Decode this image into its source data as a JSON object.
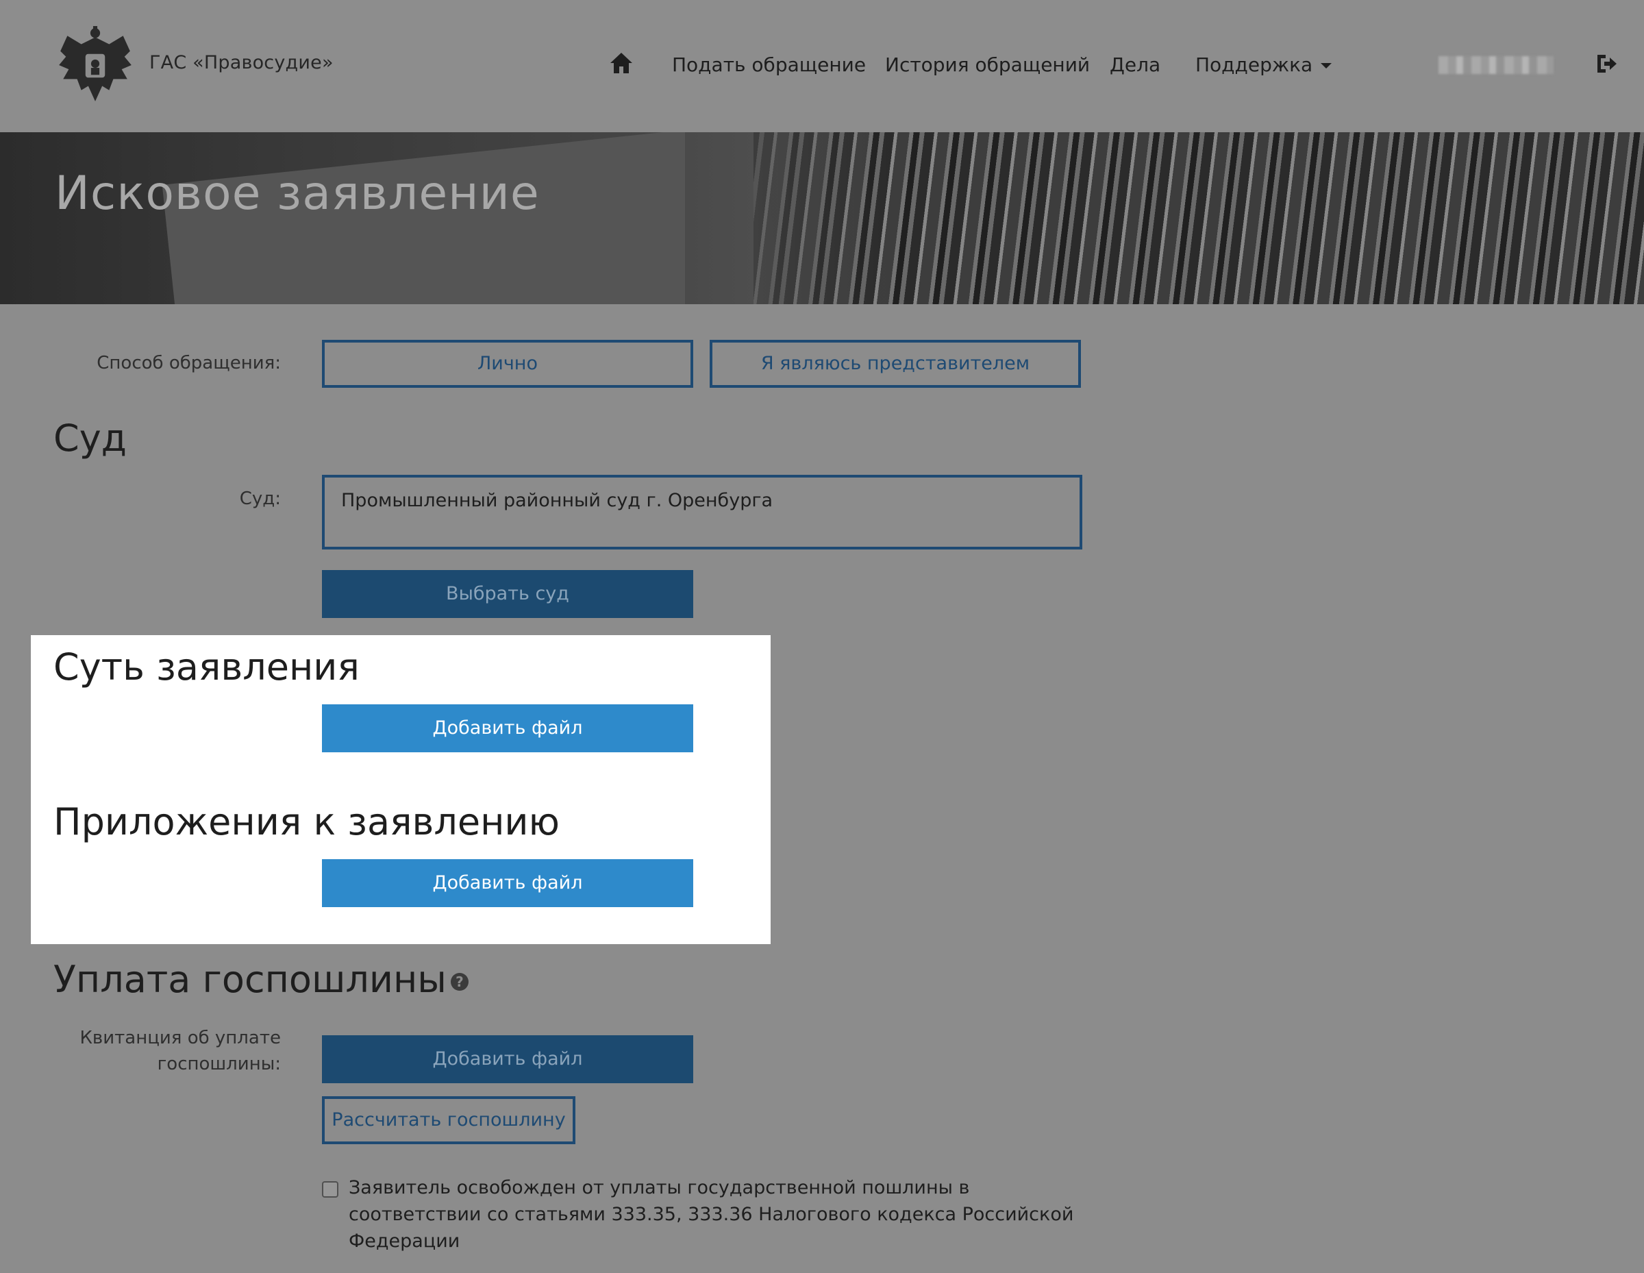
{
  "header": {
    "brand": "ГАС «Правосудие»",
    "nav": {
      "submit": "Подать обращение",
      "history": "История обращений",
      "cases": "Дела",
      "support": "Поддержка"
    }
  },
  "banner": {
    "title": "Исковое заявление"
  },
  "form": {
    "method": {
      "label": "Способ обращения:",
      "personal": "Лично",
      "representative": "Я являюсь представителем"
    },
    "court_section": {
      "title": "Суд",
      "label": "Суд:",
      "value": "Промышленный районный суд г. Оренбурга",
      "select_button": "Выбрать суд"
    },
    "essence_section": {
      "title": "Суть заявления",
      "add_file": "Добавить файл"
    },
    "attachments_section": {
      "title": "Приложения к заявлению",
      "add_file": "Добавить файл"
    },
    "fee_section": {
      "title": "Уплата госпошлины",
      "receipt_label_line1": "Квитанция об уплате",
      "receipt_label_line2": "госпошлины:",
      "add_file": "Добавить файл",
      "calculate": "Рассчитать госпошлину",
      "exempt_text": "Заявитель освобожден от уплаты государственной пошлины в соответствии со статьями 333.35, 333.36 Налогового кодекса Российской Федерации"
    }
  },
  "colors": {
    "primary_dark": "#1c4a70",
    "primary_blue": "#2e8acb",
    "outline": "#1e4a73",
    "overlay_gray": "#8c8c8c"
  }
}
